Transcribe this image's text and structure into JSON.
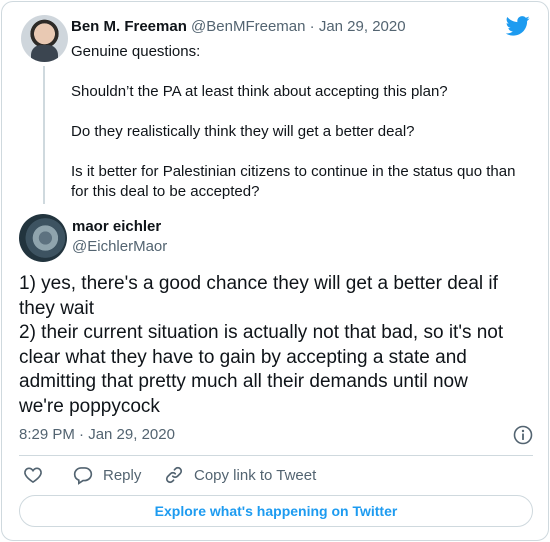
{
  "parent_tweet": {
    "author_name": "Ben M. Freeman",
    "handle": "@BenMFreeman",
    "separator": "·",
    "date": "Jan 29, 2020",
    "paragraphs": [
      "Genuine questions:",
      "Shouldn’t the PA at least think about accepting this plan?",
      "Do they realistically think they will get a better deal?",
      "Is it better for Palestinian citizens to continue in the status quo than for this deal to be accepted?"
    ]
  },
  "main_tweet": {
    "author_name": "maor eichler",
    "handle": "@EichlerMaor",
    "text_lines": [
      "1) yes, there's a good chance they will get a better deal if",
      "they wait",
      "2) their current situation is actually not that bad, so it's not",
      "clear what they have to gain by accepting a state and",
      "admitting that pretty much all their demands until now",
      "we're poppycock"
    ],
    "timestamp": "8:29 PM · Jan 29, 2020"
  },
  "actions": {
    "reply_label": "Reply",
    "copy_link_label": "Copy link to Tweet"
  },
  "explore_button_label": "Explore what's happening on Twitter",
  "icons": {
    "brand": "twitter-bird-icon",
    "info": "info-icon",
    "like": "heart-icon",
    "reply": "comment-icon",
    "copy": "link-icon"
  },
  "colors": {
    "brand_blue": "#1d9bf0",
    "text_primary": "#0f1419",
    "text_secondary": "#536471",
    "border": "#cfd9de"
  }
}
